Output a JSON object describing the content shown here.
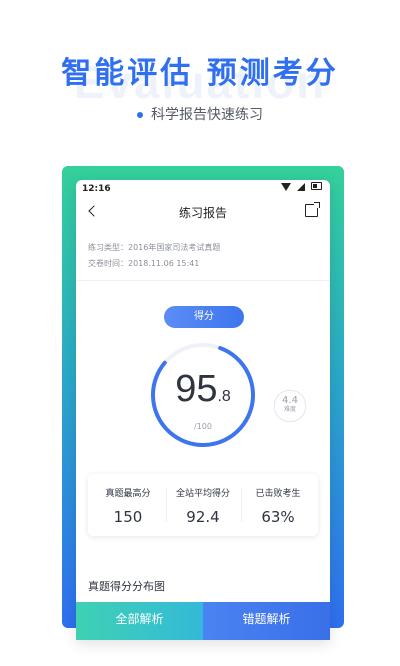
{
  "hero": {
    "title": "智能评估  预测考分",
    "watermark": "Evaluation",
    "subtitle": "科学报告快速练习"
  },
  "status_bar": {
    "time": "12:16"
  },
  "nav": {
    "title": "练习报告",
    "back_icon": "chevron-left-icon",
    "share_icon": "share-icon"
  },
  "info": {
    "type_line": "练习类型：2016年国家司法考试真题",
    "time_line": "交卷时间：2018.11.06   15:41"
  },
  "score": {
    "pill": "得分",
    "main": "95",
    "decimal": ".8",
    "total": "/100",
    "fraction": 0.958
  },
  "difficulty": {
    "value": "4.4",
    "label": "难度"
  },
  "stats": [
    {
      "label": "真题最高分",
      "value": "150"
    },
    {
      "label": "全站平均得分",
      "value": "92.4"
    },
    {
      "label": "已击败考生",
      "value": "63%"
    }
  ],
  "section": {
    "title": "真题得分分布图"
  },
  "buttons": {
    "all": "全部解析",
    "wrong": "错题解析"
  },
  "colors": {
    "accent": "#2f6ff0",
    "green": "#34d09b"
  }
}
